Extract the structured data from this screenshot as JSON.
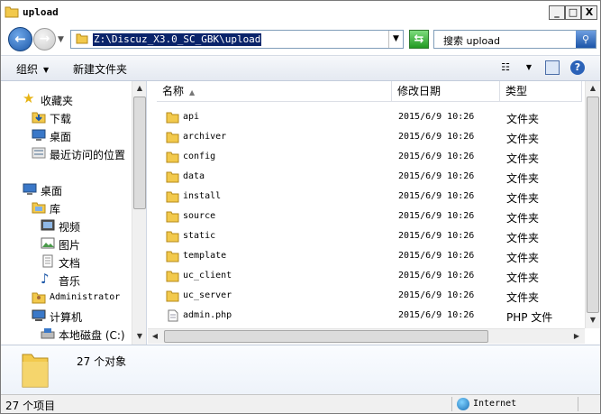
{
  "window": {
    "title": "upload",
    "buttons": [
      "_",
      "□",
      "X"
    ]
  },
  "address": {
    "path": "Z:\\Discuz_X3.0_SC_GBK\\upload",
    "search_placeholder": "搜索 upload"
  },
  "toolbar": {
    "organize_label": "组织",
    "new_folder_label": "新建文件夹"
  },
  "nav": {
    "favorites": {
      "label": "收藏夹",
      "items": [
        {
          "label": "下载",
          "icon": "downloads-icon"
        },
        {
          "label": "桌面",
          "icon": "desktop-icon"
        },
        {
          "label": "最近访问的位置",
          "icon": "recent-places-icon"
        }
      ]
    },
    "desktop": {
      "label": "桌面",
      "library": {
        "label": "库",
        "items": [
          {
            "label": "视频",
            "icon": "video-icon"
          },
          {
            "label": "图片",
            "icon": "picture-icon"
          },
          {
            "label": "文档",
            "icon": "document-icon"
          },
          {
            "label": "音乐",
            "icon": "music-icon"
          }
        ]
      },
      "user": "Administrator",
      "computer": {
        "label": "计算机",
        "drive": "本地磁盘 (C:)"
      }
    }
  },
  "columns": {
    "name": "名称",
    "modified": "修改日期",
    "type": "类型"
  },
  "files": [
    {
      "name": "api",
      "modified": "2015/6/9 10:26",
      "type": "文件夹",
      "kind": "folder"
    },
    {
      "name": "archiver",
      "modified": "2015/6/9 10:26",
      "type": "文件夹",
      "kind": "folder"
    },
    {
      "name": "config",
      "modified": "2015/6/9 10:26",
      "type": "文件夹",
      "kind": "folder"
    },
    {
      "name": "data",
      "modified": "2015/6/9 10:26",
      "type": "文件夹",
      "kind": "folder"
    },
    {
      "name": "install",
      "modified": "2015/6/9 10:26",
      "type": "文件夹",
      "kind": "folder"
    },
    {
      "name": "source",
      "modified": "2015/6/9 10:26",
      "type": "文件夹",
      "kind": "folder"
    },
    {
      "name": "static",
      "modified": "2015/6/9 10:26",
      "type": "文件夹",
      "kind": "folder"
    },
    {
      "name": "template",
      "modified": "2015/6/9 10:26",
      "type": "文件夹",
      "kind": "folder"
    },
    {
      "name": "uc_client",
      "modified": "2015/6/9 10:26",
      "type": "文件夹",
      "kind": "folder"
    },
    {
      "name": "uc_server",
      "modified": "2015/6/9 10:26",
      "type": "文件夹",
      "kind": "folder"
    },
    {
      "name": "admin.php",
      "modified": "2015/6/9 10:26",
      "type": "PHP 文件",
      "kind": "file"
    }
  ],
  "details": {
    "count": "27 个对象"
  },
  "status": {
    "items": "27 个项目",
    "zone": "Internet"
  },
  "colors": {
    "folder": "#f2c94c",
    "selection": "#0a246a",
    "accent": "#1d58a8"
  }
}
